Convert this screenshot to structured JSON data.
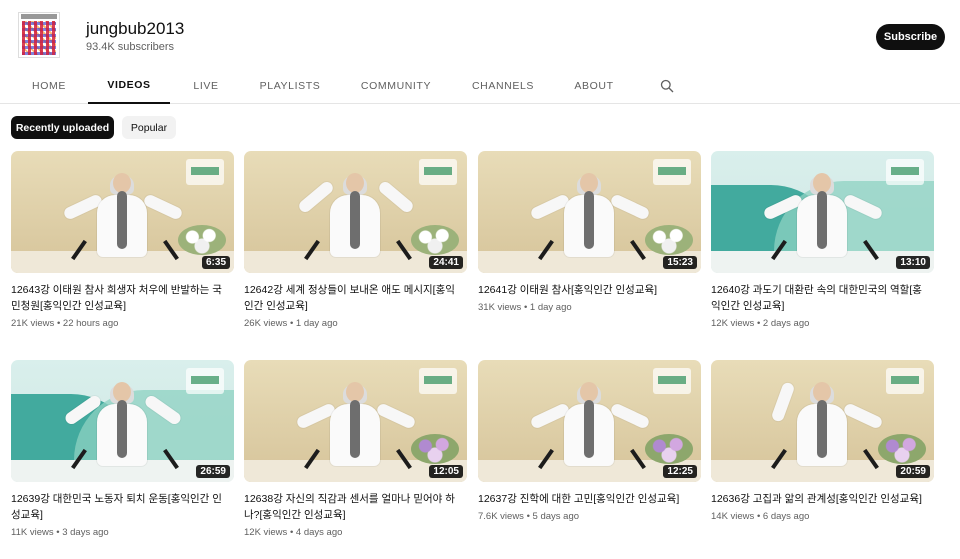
{
  "channel": {
    "name": "jungbub2013",
    "subscribers": "93.4K subscribers",
    "subscribe_label": "Subscribe"
  },
  "tabs": [
    "HOME",
    "VIDEOS",
    "LIVE",
    "PLAYLISTS",
    "COMMUNITY",
    "CHANNELS",
    "ABOUT"
  ],
  "active_tab": "VIDEOS",
  "chips": [
    "Recently uploaded",
    "Popular"
  ],
  "videos": [
    {
      "duration": "6:35",
      "title": "12643강 이태원 참사 희생자 처우에 반발하는 국민청원[홍익인간 인성교육]",
      "views": "21K views",
      "age": "22 hours ago"
    },
    {
      "duration": "24:41",
      "title": "12642강 세계 정상들이 보내온 애도 메시지[홍익인간 인성교육]",
      "views": "26K views",
      "age": "1 day ago"
    },
    {
      "duration": "15:23",
      "title": "12641강 이태원 참사[홍익인간 인성교육]",
      "views": "31K views",
      "age": "1 day ago"
    },
    {
      "duration": "13:10",
      "title": "12640강 과도기 대환란 속의 대한민국의 역할[홍익인간 인성교육]",
      "views": "12K views",
      "age": "2 days ago"
    },
    {
      "duration": "26:59",
      "title": "12639강 대한민국 노동자 퇴치 운동[홍익인간 인성교육]",
      "views": "11K views",
      "age": "3 days ago"
    },
    {
      "duration": "12:05",
      "title": "12638강 자신의 직감과 센서를 얼마나 믿어야 하나?[홍익인간 인성교육]",
      "views": "12K views",
      "age": "4 days ago"
    },
    {
      "duration": "12:25",
      "title": "12637강 진학에 대한 고민[홍익인간 인성교육]",
      "views": "7.6K views",
      "age": "5 days ago"
    },
    {
      "duration": "20:59",
      "title": "12636강 고집과 앎의 관계성[홍익인간 인성교육]",
      "views": "14K views",
      "age": "6 days ago"
    }
  ]
}
